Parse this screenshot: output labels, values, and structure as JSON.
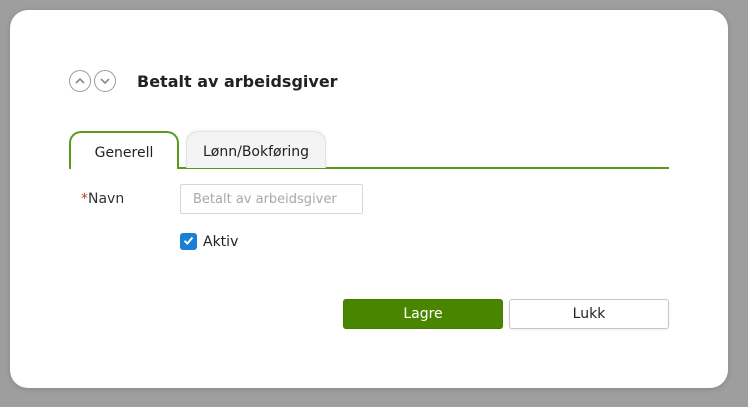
{
  "dialog": {
    "title": "Betalt av arbeidsgiver",
    "nav": {
      "up_icon": "chevron-up-icon",
      "down_icon": "chevron-down-icon"
    }
  },
  "tabs": [
    {
      "label": "Generell",
      "active": true
    },
    {
      "label": "Lønn/Bokføring",
      "active": false
    }
  ],
  "form": {
    "name_required_marker": "*",
    "name_label": "Navn",
    "name_placeholder": "Betalt av arbeidsgiver",
    "name_value": "",
    "active_label": "Aktiv",
    "active_checked": true
  },
  "buttons": {
    "save_label": "Lagre",
    "close_label": "Lukk"
  },
  "colors": {
    "accent_green": "#5b9a1d",
    "save_button": "#4a8500",
    "checkbox_blue": "#1a7fd6",
    "required_red": "#c0392b"
  }
}
